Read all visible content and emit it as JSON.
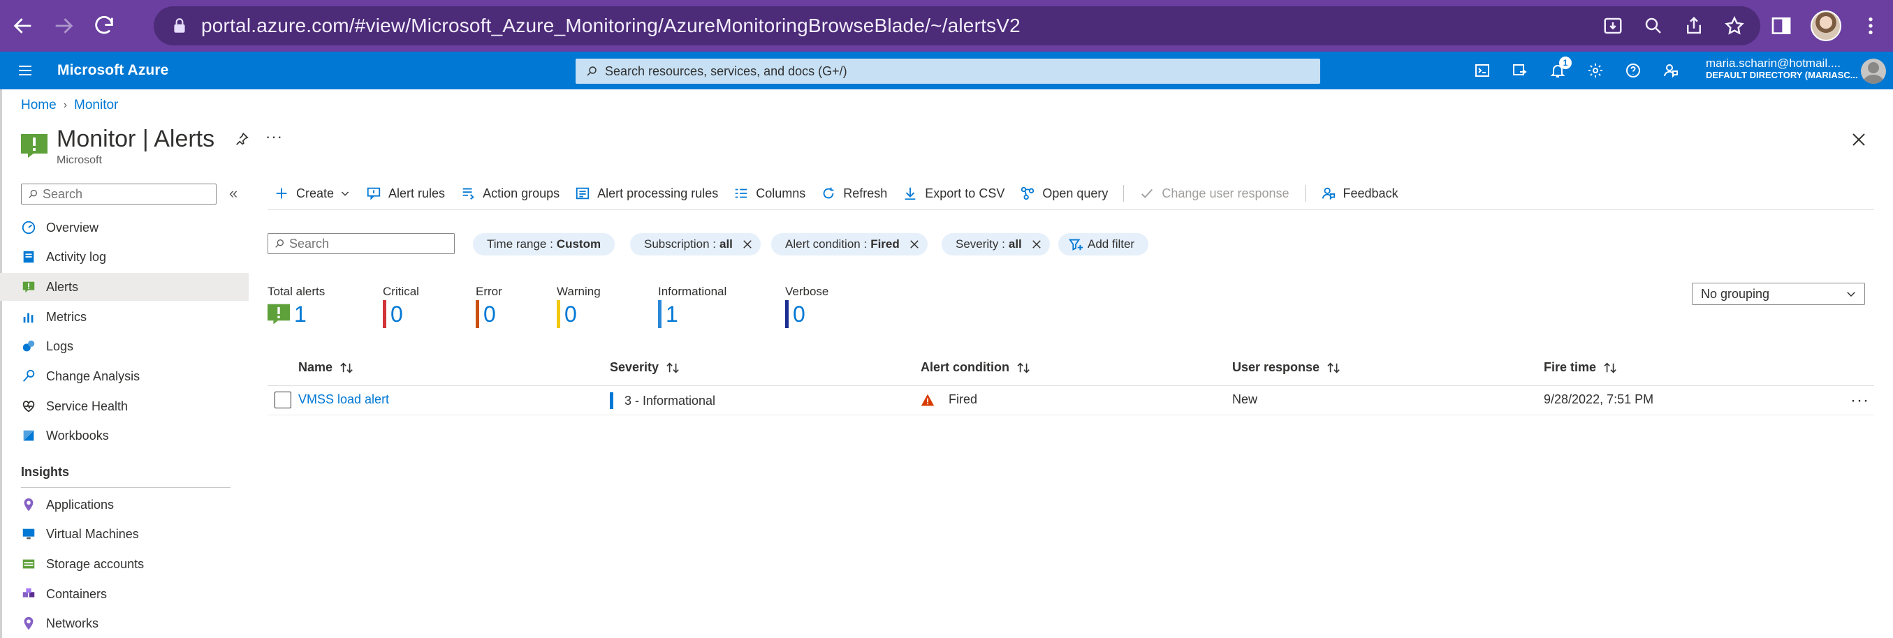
{
  "browser": {
    "url": "portal.azure.com/#view/Microsoft_Azure_Monitoring/AzureMonitoringBrowseBlade/~/alertsV2"
  },
  "azure": {
    "brand": "Microsoft Azure",
    "search_placeholder": "Search resources, services, and docs (G+/)",
    "notification_count": "1",
    "account_email": "maria.scharin@hotmail....",
    "account_directory": "DEFAULT DIRECTORY (MARIASC..."
  },
  "breadcrumb": [
    "Home",
    "Monitor"
  ],
  "page": {
    "title": "Monitor | Alerts",
    "subtitle": "Microsoft",
    "ellipsis": "···"
  },
  "sidebar": {
    "search_placeholder": "Search",
    "collapse": "«",
    "items": [
      {
        "label": "Overview",
        "icon": "overview-icon"
      },
      {
        "label": "Activity log",
        "icon": "activity-log-icon"
      },
      {
        "label": "Alerts",
        "icon": "alerts-icon",
        "active": true
      },
      {
        "label": "Metrics",
        "icon": "metrics-icon"
      },
      {
        "label": "Logs",
        "icon": "logs-icon"
      },
      {
        "label": "Change Analysis",
        "icon": "change-analysis-icon"
      },
      {
        "label": "Service Health",
        "icon": "service-health-icon"
      },
      {
        "label": "Workbooks",
        "icon": "workbooks-icon"
      }
    ],
    "section_insights": "Insights",
    "insights_items": [
      {
        "label": "Applications",
        "icon": "applications-icon"
      },
      {
        "label": "Virtual Machines",
        "icon": "virtual-machines-icon"
      },
      {
        "label": "Storage accounts",
        "icon": "storage-accounts-icon"
      },
      {
        "label": "Containers",
        "icon": "containers-icon"
      },
      {
        "label": "Networks",
        "icon": "networks-icon"
      }
    ]
  },
  "toolbar": {
    "create": "Create",
    "alert_rules": "Alert rules",
    "action_groups": "Action groups",
    "alert_processing_rules": "Alert processing rules",
    "columns": "Columns",
    "refresh": "Refresh",
    "export_csv": "Export to CSV",
    "open_query": "Open query",
    "change_user_response": "Change user response",
    "feedback": "Feedback"
  },
  "filters": {
    "search_placeholder": "Search",
    "pills": [
      {
        "label": "Time range :",
        "value": "Custom",
        "removable": false
      },
      {
        "label": "Subscription :",
        "value": "all",
        "removable": true
      },
      {
        "label": "Alert condition :",
        "value": "Fired",
        "removable": true
      },
      {
        "label": "Severity :",
        "value": "all",
        "removable": true
      }
    ],
    "add_filter": "Add filter"
  },
  "summary": [
    {
      "label": "Total alerts",
      "value": "1",
      "color": "#107c10"
    },
    {
      "label": "Critical",
      "value": "0",
      "color": "#d13438"
    },
    {
      "label": "Error",
      "value": "0",
      "color": "#ca5010"
    },
    {
      "label": "Warning",
      "value": "0",
      "color": "#f2c811"
    },
    {
      "label": "Informational",
      "value": "1",
      "color": "#2b88d8"
    },
    {
      "label": "Verbose",
      "value": "0",
      "color": "#1b2e8f"
    }
  ],
  "grouping": {
    "selected": "No grouping"
  },
  "table": {
    "columns": [
      "Name",
      "Severity",
      "Alert condition",
      "User response",
      "Fire time"
    ],
    "rows": [
      {
        "name": "VMSS load alert",
        "severity": "3 - Informational",
        "condition": "Fired",
        "user_response": "New",
        "fire_time": "9/28/2022, 7:51 PM"
      }
    ],
    "more": "···"
  }
}
